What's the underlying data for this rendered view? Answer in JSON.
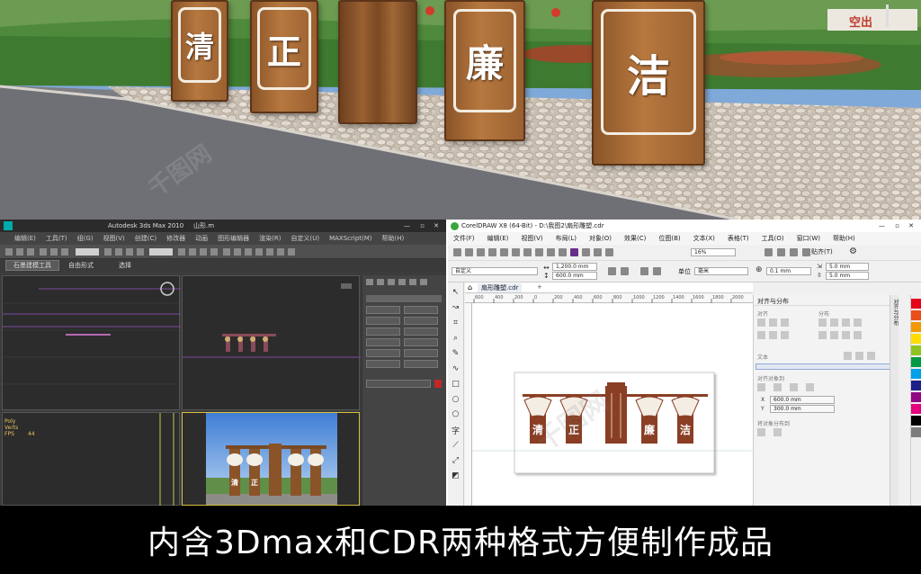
{
  "scene": {
    "sign_characters": [
      "清",
      "正",
      "廉",
      "洁"
    ],
    "background_sign_text": "空出"
  },
  "watermark": "千图网",
  "max_window": {
    "title": "Autodesk 3ds Max  2010",
    "file": "山形.m",
    "menus": [
      "编辑(E)",
      "工具(T)",
      "组(G)",
      "视图(V)",
      "创建(C)",
      "修改器",
      "动画",
      "图形编辑器",
      "渲染(R)",
      "自定义(U)",
      "MAXScript(M)",
      "帮助(H)"
    ],
    "ribbon_tabs": [
      "石墨建模工具",
      "自由形式",
      "选择"
    ],
    "stats_text": "Poly\nVerts\nFPS",
    "stats_value": "44"
  },
  "cdr_window": {
    "title": "CorelDRAW X8 (64-Bit) - D:\\我图2\\扇形雕塑.cdr",
    "menus": [
      "文件(F)",
      "编辑(E)",
      "视图(V)",
      "布局(L)",
      "对象(O)",
      "效果(C)",
      "位图(B)",
      "文本(X)",
      "表格(T)",
      "工具(O)",
      "窗口(W)",
      "帮助(H)"
    ],
    "zoom": "16%",
    "paste_label": "贴齐(T)",
    "page_preset": "自定义",
    "width": "1,200.0 mm",
    "height": "600.0 mm",
    "unit_label": "单位",
    "unit_value": "毫米",
    "nudge": "0.1 mm",
    "dup_x": "5.0 mm",
    "dup_y": "5.0 mm",
    "doc_tab": "扇形雕塑.cdr",
    "ruler_ticks": [
      "600",
      "400",
      "200",
      "0",
      "200",
      "400",
      "600",
      "800",
      "1000",
      "1200",
      "1400",
      "1600",
      "1800",
      "2000"
    ],
    "docker": {
      "title": "对齐与分布",
      "section_align": "对齐",
      "section_distribute": "分布",
      "section_text": "文本",
      "section_objects": "对齐对象到",
      "x_label": "X",
      "x_value": "600.0 mm",
      "y_label": "Y",
      "y_value": "300.0 mm",
      "section_spacing": "将对象分布到",
      "side_tab": "对齐与分布"
    },
    "design_characters": [
      "清",
      "正",
      "廉",
      "洁"
    ],
    "palette_colors": [
      "#e6001a",
      "#e94e1b",
      "#f39800",
      "#ffdd00",
      "#8fc31f",
      "#009944",
      "#00a0e9",
      "#1d2088",
      "#920783",
      "#e4007f",
      "#000000",
      "#7d7d7d"
    ]
  },
  "caption": "内含3Dmax和CDR两种格式方便制作成品"
}
